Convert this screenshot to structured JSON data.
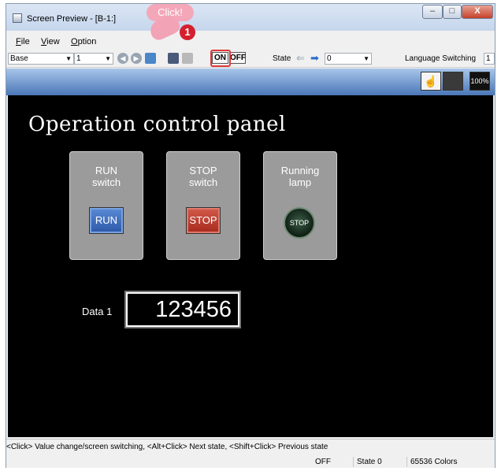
{
  "window": {
    "title": "Screen Preview - [B-1:]",
    "controls": {
      "minimize": "–",
      "maximize": "□",
      "close": "X"
    }
  },
  "menu": {
    "items": [
      "File",
      "View",
      "Option"
    ]
  },
  "toolbar": {
    "screen_type": "Base",
    "screen_number": "1",
    "on_label": "ON",
    "off_label": "OFF",
    "state_label": "State",
    "state_value": "0",
    "language_label": "Language Switching",
    "language_value": "1"
  },
  "callout": {
    "text": "Click!",
    "badge": "1"
  },
  "ribbon": {
    "zoom_label": "100%"
  },
  "panel": {
    "title": "Operation control panel",
    "cards": [
      {
        "label": "RUN\nswitch",
        "control": "RUN"
      },
      {
        "label": "STOP\nswitch",
        "control": "STOP"
      },
      {
        "label": "Running\nlamp",
        "control": "STOP"
      }
    ],
    "data_label": "Data 1",
    "data_value": "123456"
  },
  "status": {
    "hint": "<Click> Value change/screen switching, <Alt+Click> Next state, <Shift+Click> Previous state",
    "mode": "OFF",
    "state": "State 0",
    "colors": "65536 Colors"
  },
  "colors": {
    "accent_highlight": "#e0393a",
    "run_blue": "#2c57a8",
    "stop_red": "#a62a1d",
    "screen_bg": "#000000"
  }
}
